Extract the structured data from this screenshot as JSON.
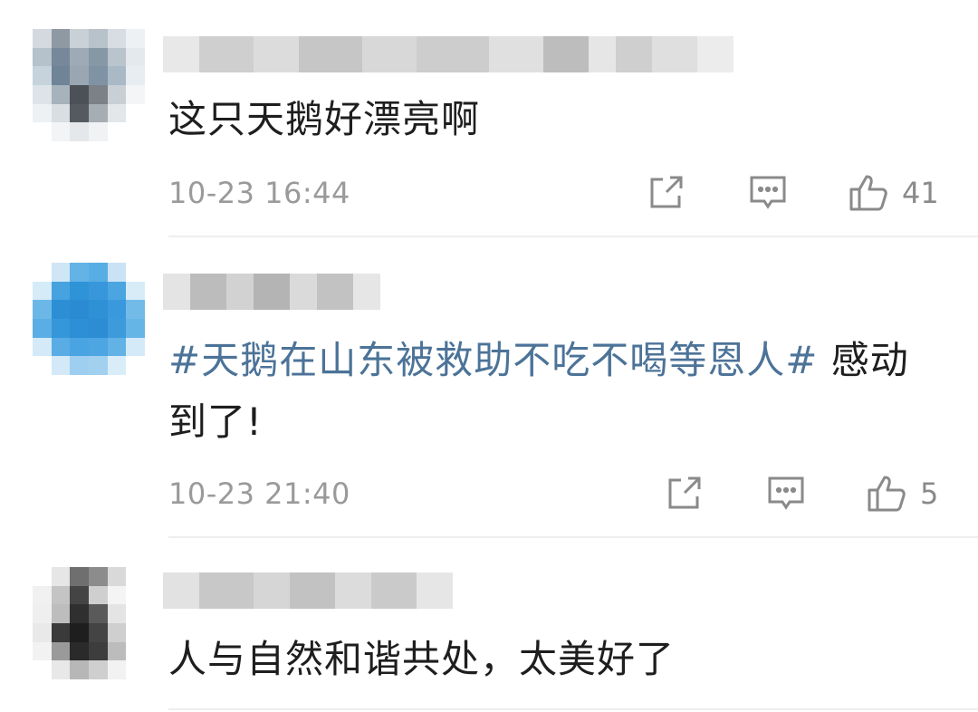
{
  "comments": [
    {
      "text": "这只天鹅好漂亮啊",
      "time": "10-23 16:44",
      "likes": "41",
      "icons": {
        "share": "share-icon",
        "reply": "comment-icon",
        "like": "thumbs-up-icon"
      }
    },
    {
      "topic": "#天鹅在山东被救助不吃不喝等恩人#",
      "text": "感动到了!",
      "time": "10-23 21:40",
      "likes": "5",
      "icons": {
        "share": "share-icon",
        "reply": "comment-icon",
        "like": "thumbs-up-icon"
      }
    },
    {
      "text": "人与自然和谐共处，太美好了"
    }
  ],
  "colors": {
    "topic": "#4c7398",
    "meta": "#9a9a9a",
    "divider": "#eeeeee"
  }
}
